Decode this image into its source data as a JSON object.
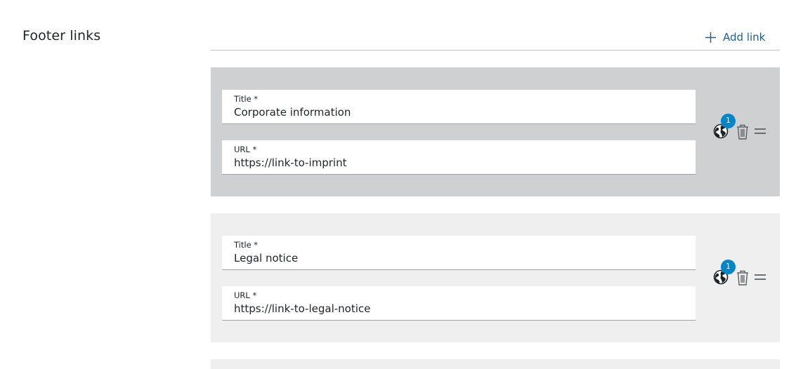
{
  "section": {
    "title": "Footer links",
    "add_link_label": "Add link"
  },
  "links": [
    {
      "title_label": "Title *",
      "title_value": "Corporate information",
      "url_label": "URL *",
      "url_value": "https://link-to-imprint",
      "translations_badge": "1",
      "state": "active"
    },
    {
      "title_label": "Title *",
      "title_value": "Legal notice",
      "url_label": "URL *",
      "url_value": "https://link-to-legal-notice",
      "translations_badge": "1",
      "state": "idle"
    }
  ],
  "colors": {
    "accent": "#1d5e96",
    "badge": "#0086c9",
    "card_active": "#cfd0d1",
    "card_idle": "#efefef"
  },
  "icons": [
    "plus-icon",
    "globe-icon",
    "trash-icon",
    "drag-handle-icon"
  ]
}
